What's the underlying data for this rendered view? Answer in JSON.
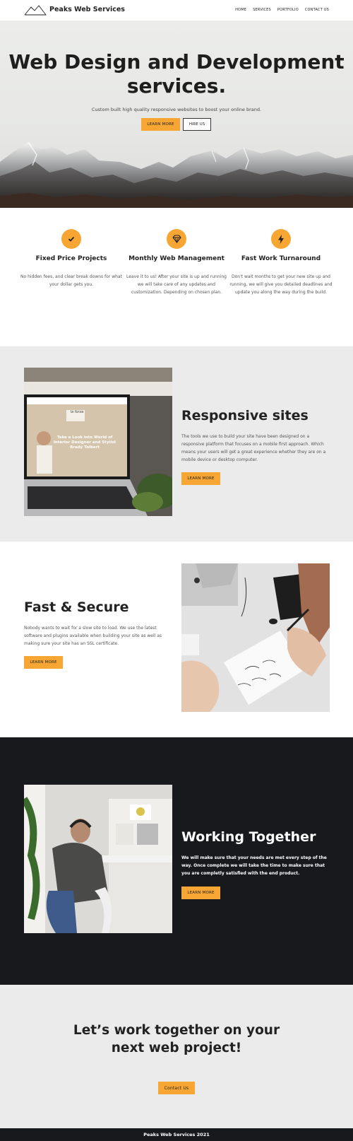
{
  "nav": {
    "brand": "Peaks Web Services",
    "items": [
      "HOME",
      "SERVICES",
      "PORTFOLIO",
      "CONTACT US"
    ]
  },
  "hero": {
    "title_line1": "Web Design and Development",
    "title_line2": "services.",
    "subtitle": "Custom built high quality responsive websites to boost your online brand.",
    "learn_more": "LEARN MORE",
    "hire_us": "HIRE US"
  },
  "features": [
    {
      "icon": "check-icon",
      "title": "Fixed Price Projects",
      "text": "No hidden fees, and clear break downs for what your dollar gets you."
    },
    {
      "icon": "diamond-icon",
      "title": "Monthly Web Management",
      "text": "Leave it to us! After your site is up and running we will take care of any updates and customization. Depending on chosen plan."
    },
    {
      "icon": "bolt-icon",
      "title": "Fast Work Turnaround",
      "text": "Don't wait months to get your new site up and running, we will give you detailed deadlines and update you along the way during the build."
    }
  ],
  "responsive": {
    "title": "Responsive sites",
    "text": "The tools we use to build your site have been designed on a responsive platform that focuses on a mobile first approach. Which means your users will get a great experience whether they are on a mobile device or desktop computer.",
    "button": "LEARN MORE",
    "laptop_heading": "Take a Look into World of Interior Designer and Stylist Brady Tolbert",
    "laptop_logo": "la forza"
  },
  "secure": {
    "title": "Fast & Secure",
    "text": "Nobody wants to wait for a slow site to load. We use the latest software and plugins available when building your site as well as making sure your site has an SSL certificate.",
    "button": "LEARN MORE"
  },
  "together": {
    "title": "Working Together",
    "text": "We will make sure that your needs are met every step of the way. Once complete we will take the time to make sure that you are completly satisfied with the end product.",
    "button": "LEARN MORE"
  },
  "cta": {
    "title_line1": "Let’s work together on your",
    "title_line2": "next web project!",
    "button": "Contact Us"
  },
  "footer": {
    "text": "Peaks Web Services 2021"
  },
  "colors": {
    "accent": "#f7a633",
    "dark": "#18191d",
    "gray_section": "#ebebeb"
  }
}
